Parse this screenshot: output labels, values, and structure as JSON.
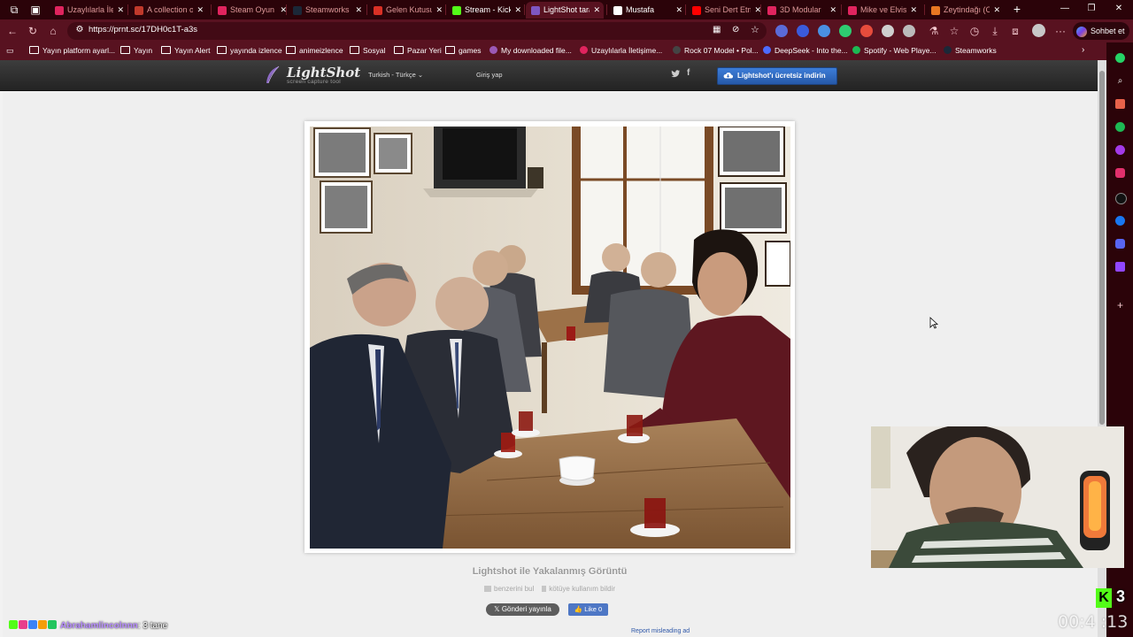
{
  "browser": {
    "tabs": [
      {
        "label": "Uzaylılarla İleti",
        "color": "#e0245e"
      },
      {
        "label": "A collection o",
        "color": "#c0392b"
      },
      {
        "label": "Steam Oyun",
        "color": "#e0245e"
      },
      {
        "label": "Steamworks",
        "color": "#1b2838"
      },
      {
        "label": "Gelen Kutusu",
        "color": "#d93025"
      },
      {
        "label": "Stream - Kick",
        "color": "#53fc18"
      },
      {
        "label": "LightShot tara",
        "color": "#7e57c2"
      },
      {
        "label": "Mustafa",
        "color": "#ffffff"
      },
      {
        "label": "Seni Dert Etm",
        "color": "#ff0000"
      },
      {
        "label": "3D Modular",
        "color": "#e0245e"
      },
      {
        "label": "Mike ve Elvis",
        "color": "#e0245e"
      },
      {
        "label": "Zeytindağı (C",
        "color": "#e87722"
      }
    ],
    "url": "https://prnt.sc/17DH0c1T-a3s",
    "chat_button": "Sohbet et",
    "bookmarks": [
      {
        "label": "Yayın platform ayarl...",
        "type": "folder"
      },
      {
        "label": "Yayın",
        "type": "folder"
      },
      {
        "label": "Yayın Alert",
        "type": "folder"
      },
      {
        "label": "yayında izlence",
        "type": "folder"
      },
      {
        "label": "animeizlence",
        "type": "folder"
      },
      {
        "label": "Sosyal",
        "type": "folder"
      },
      {
        "label": "Pazar Yeri",
        "type": "folder"
      },
      {
        "label": "games",
        "type": "folder"
      },
      {
        "label": "My downloaded file...",
        "type": "site",
        "color": "#9b59b6"
      },
      {
        "label": "Uzaylılarla İletişime...",
        "type": "site",
        "color": "#e0245e"
      },
      {
        "label": "Rock 07 Model • Pol...",
        "type": "site",
        "color": "#444444"
      },
      {
        "label": "DeepSeek - Into the...",
        "type": "site",
        "color": "#4d6bfe"
      },
      {
        "label": "Spotify - Web Playe...",
        "type": "site",
        "color": "#1db954"
      },
      {
        "label": "Steamworks",
        "type": "site",
        "color": "#1b2838"
      }
    ]
  },
  "lightshot": {
    "logo": "LightShot",
    "logo_sub": "screen capture tool",
    "language": "Turkish - Türkçe",
    "login": "Giriş yap",
    "download_button": "Lightshot'ı ücretsiz indirin",
    "caption": "Lightshot ile Yakalanmış Görüntü",
    "link_similar": "benzerini bul",
    "link_report": "kötüye kullanım bildir",
    "tweet_button": "Gönderi yayınla",
    "like_button": "Like 0",
    "report_ad": "Report misleading ad"
  },
  "stream": {
    "kick_count": "3",
    "timer": "00:4 :13",
    "chat_user": "Abrahamlincolnnn",
    "chat_message": ": 3 tane"
  },
  "colors": {
    "tab_strip": "#2b0309",
    "toolbar": "#581220",
    "kick_green": "#53fc18",
    "lightshot_blue": "#2f6bc4"
  }
}
